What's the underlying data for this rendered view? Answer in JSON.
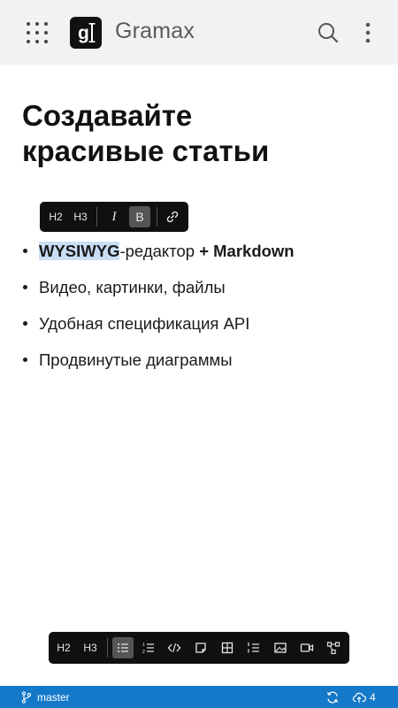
{
  "header": {
    "app_title": "Gramax",
    "logo_letter": "g",
    "icons": [
      "apps-grid-icon",
      "search-icon",
      "more-vertical-icon"
    ]
  },
  "main": {
    "title_line1": "Создавайте",
    "title_line2": "красивые статьи",
    "list": {
      "item1": {
        "highlighted": "WYSIWYG",
        "middle": "-редактор ",
        "bold": "+ Markdown"
      },
      "item2": "Видео, картинки, файлы",
      "item3": "Удобная спецификация API",
      "item4": "Продвинутые диаграммы"
    }
  },
  "float_toolbar": {
    "h2": "H2",
    "h3": "H3",
    "italic": "I",
    "bold": "B",
    "active": "bold",
    "icons": [
      "link-icon"
    ]
  },
  "bottom_toolbar": {
    "h2": "H2",
    "h3": "H3",
    "active": "bullet-list",
    "icons": [
      "bullet-list-icon",
      "ordered-list-icon",
      "code-icon",
      "note-icon",
      "table-icon",
      "task-list-icon",
      "image-icon",
      "video-icon",
      "diagram-icon"
    ]
  },
  "status_bar": {
    "branch": "master",
    "pending_count": "4",
    "color": "#1579c9"
  }
}
